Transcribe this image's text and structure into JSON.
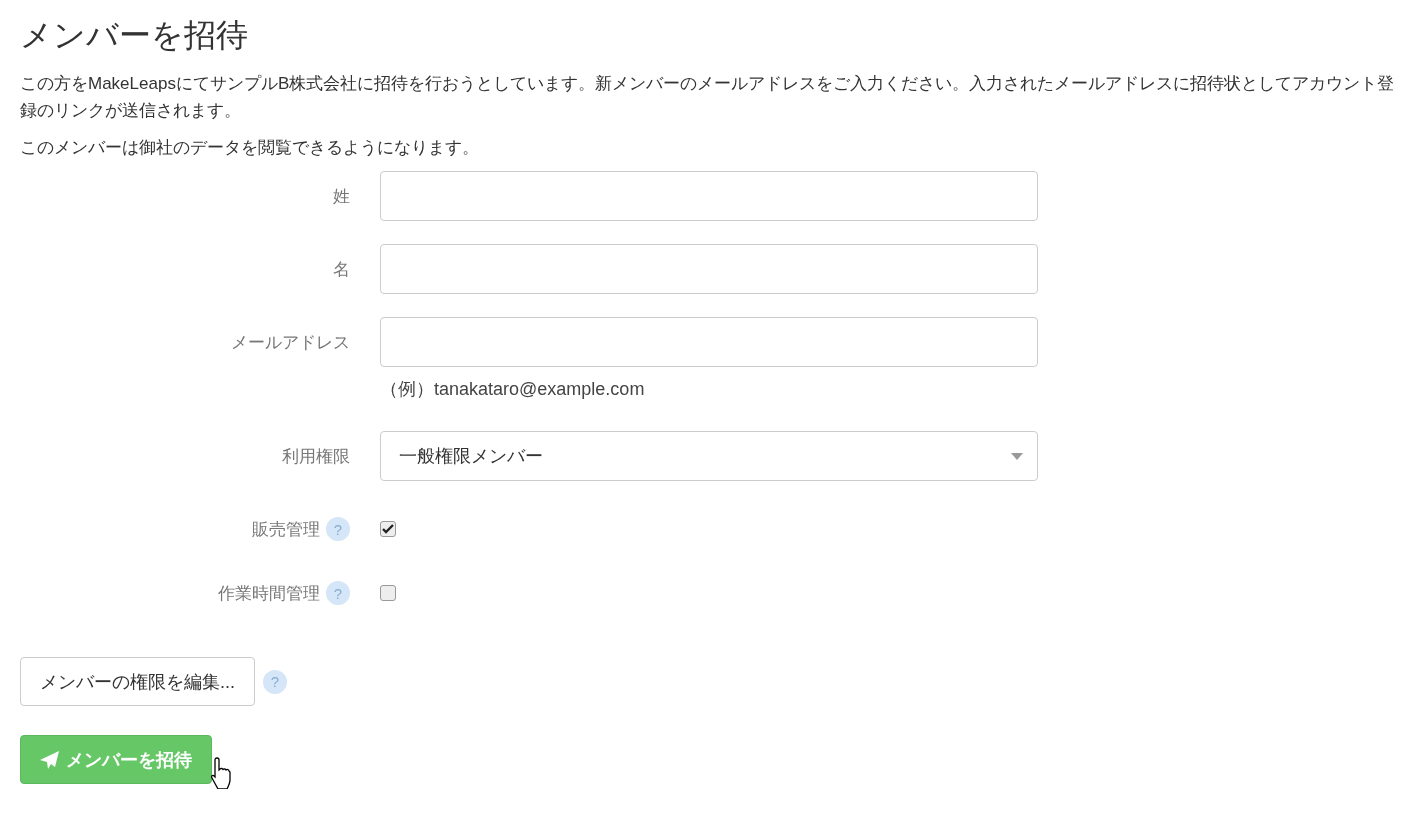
{
  "title": "メンバーを招待",
  "intro": [
    "この方をMakeLeapsにてサンプルB株式会社に招待を行おうとしています。新メンバーのメールアドレスをご入力ください。入力されたメールアドレスに招待状としてアカウント登録のリンクが送信されます。",
    "このメンバーは御社のデータを閲覧できるようになります。"
  ],
  "fields": [
    {
      "kind": "text",
      "label": "姓"
    },
    {
      "kind": "text",
      "label": "名"
    },
    {
      "kind": "text",
      "label": "メールアドレス",
      "hint": "（例）tanakataro@example.com"
    },
    {
      "kind": "select",
      "label": "利用権限",
      "value": "一般権限メンバー"
    },
    {
      "kind": "checkbox",
      "label": "販売管理",
      "help": "?",
      "checked": true
    },
    {
      "kind": "checkbox",
      "label": "作業時間管理",
      "help": "?",
      "checked": false
    }
  ],
  "edit_button": {
    "label": "メンバーの権限を編集...",
    "help": "?"
  },
  "invite_button": {
    "label": "メンバーを招待"
  }
}
